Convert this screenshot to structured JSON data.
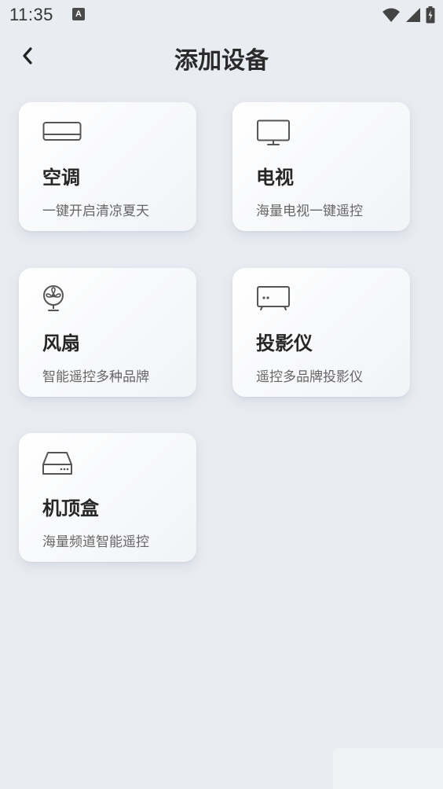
{
  "status_bar": {
    "time": "11:35",
    "notification_glyph": "A"
  },
  "header": {
    "title": "添加设备"
  },
  "devices": [
    {
      "title": "空调",
      "desc": "一键开启清凉夏天",
      "icon": "air-conditioner-icon"
    },
    {
      "title": "电视",
      "desc": "海量电视一键遥控",
      "icon": "tv-icon"
    },
    {
      "title": "风扇",
      "desc": "智能遥控多种品牌",
      "icon": "fan-icon"
    },
    {
      "title": "投影仪",
      "desc": "遥控多品牌投影仪",
      "icon": "projector-icon"
    },
    {
      "title": "机顶盒",
      "desc": "海量频道智能遥控",
      "icon": "set-top-box-icon"
    }
  ],
  "colors": {
    "background": "#e9ecf1",
    "icon_stroke": "#555555"
  }
}
